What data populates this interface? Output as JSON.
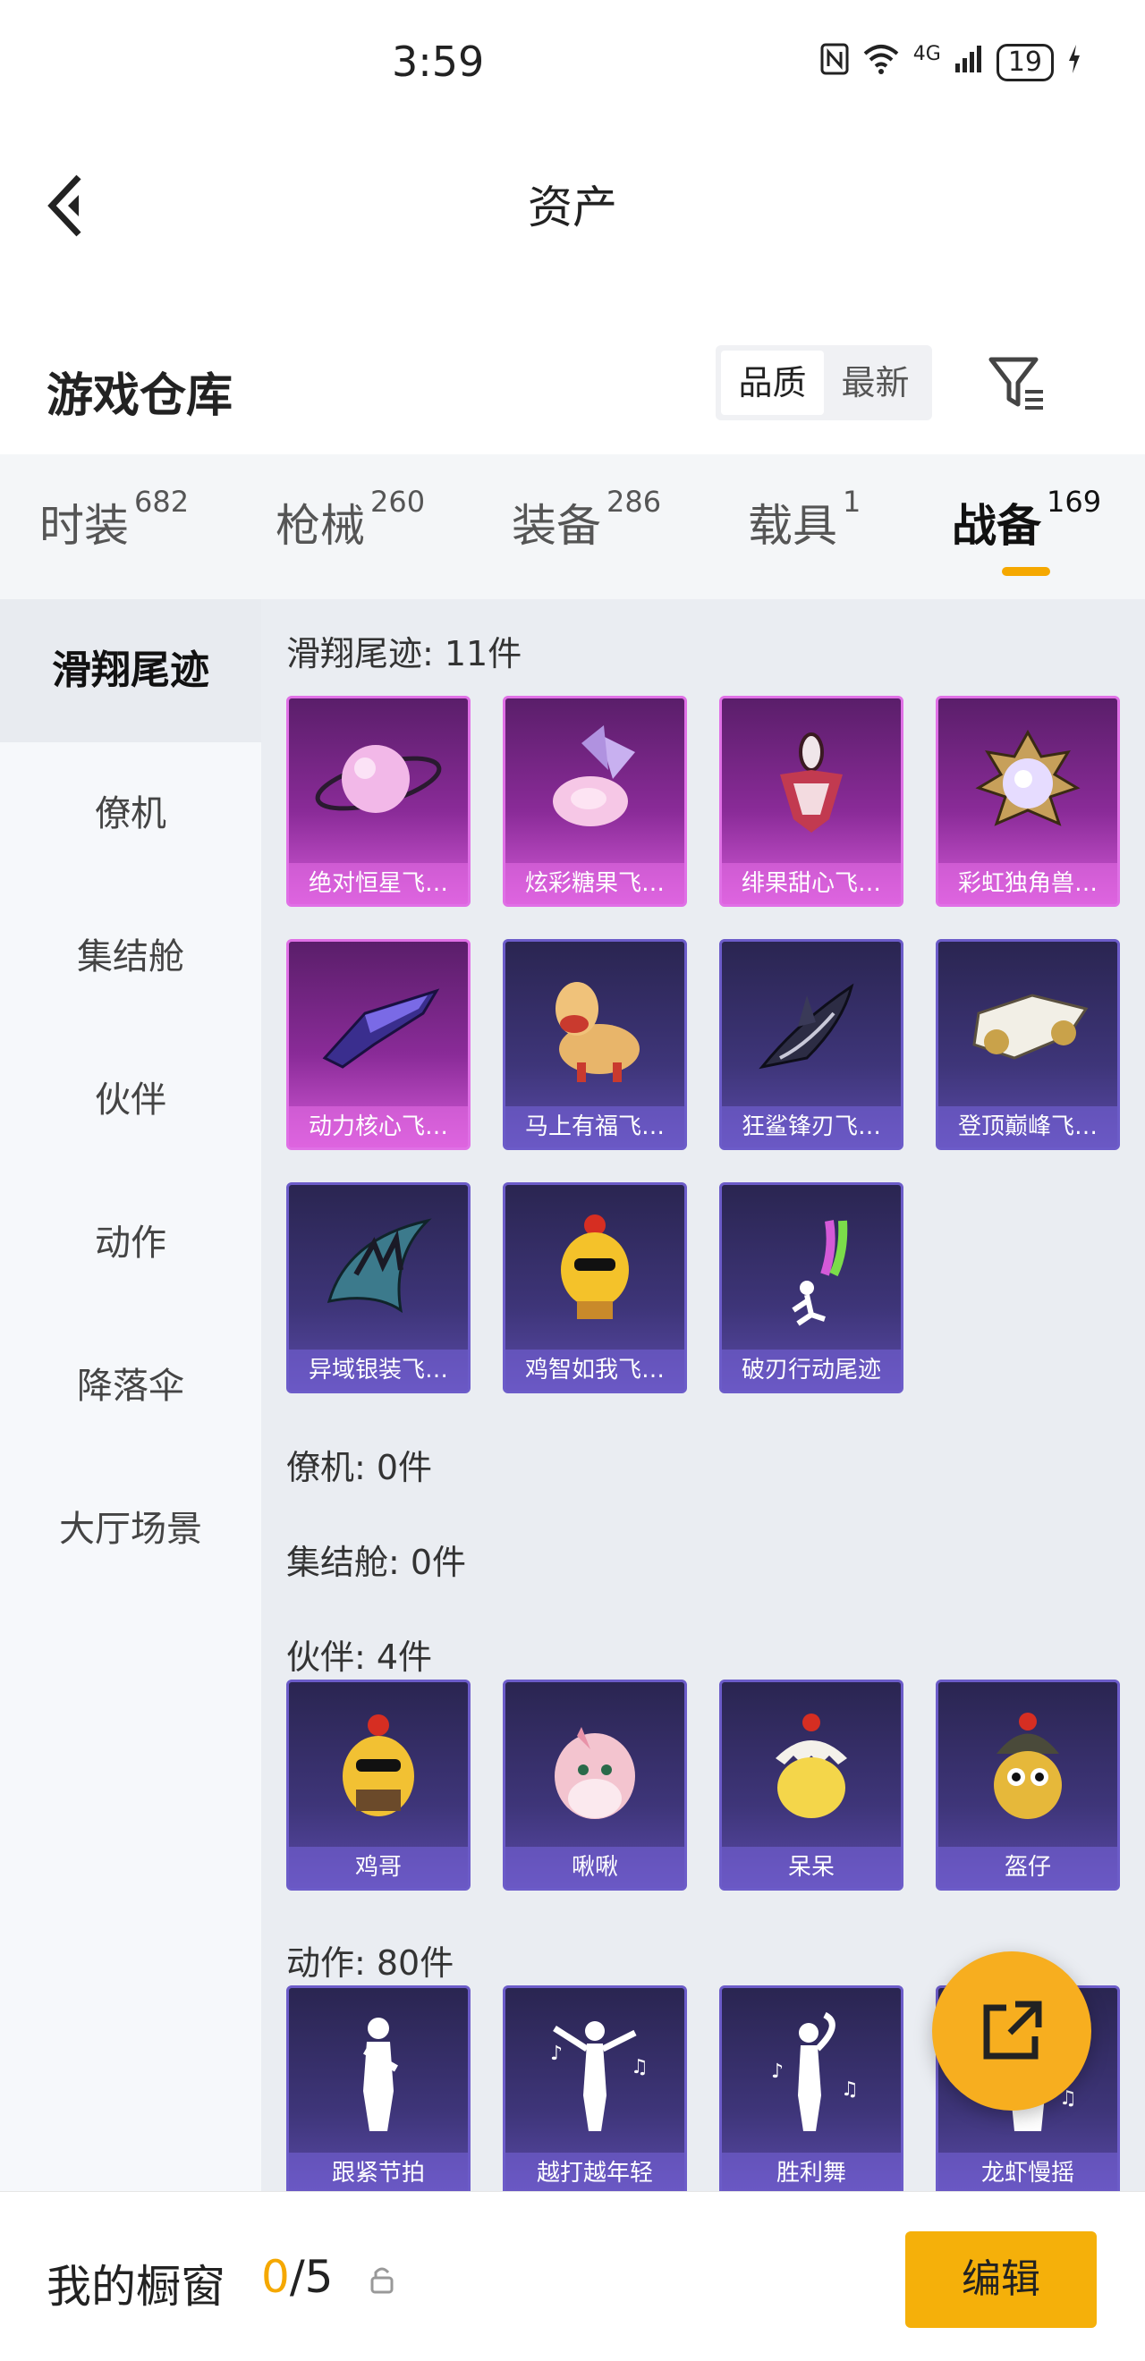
{
  "status_bar": {
    "time": "3:59",
    "network": "4G",
    "battery": "19"
  },
  "header": {
    "title": "资产"
  },
  "warehouse": {
    "title": "游戏仓库",
    "sort_options": [
      "品质",
      "最新"
    ],
    "selected_sort": "品质"
  },
  "tabs": [
    {
      "label": "时装",
      "count": "682"
    },
    {
      "label": "枪械",
      "count": "260"
    },
    {
      "label": "装备",
      "count": "286"
    },
    {
      "label": "载具",
      "count": "1"
    },
    {
      "label": "战备",
      "count": "169"
    }
  ],
  "active_tab": "战备",
  "side_nav": [
    "滑翔尾迹",
    "僚机",
    "集结舱",
    "伙伴",
    "动作",
    "降落伞",
    "大厅场景"
  ],
  "active_side_nav": "滑翔尾迹",
  "sections": {
    "glide": {
      "header": "滑翔尾迹: 11件",
      "items": [
        "绝对恒星飞…",
        "炫彩糖果飞…",
        "绯果甜心飞…",
        "彩虹独角兽…",
        "动力核心飞…",
        "马上有福飞…",
        "狂鲨锋刃飞…",
        "登顶巅峰飞…",
        "异域银装飞…",
        "鸡智如我飞…",
        "破刃行动尾迹"
      ]
    },
    "wingman": {
      "header": "僚机: 0件"
    },
    "capsule": {
      "header": "集结舱: 0件"
    },
    "partner": {
      "header": "伙伴: 4件",
      "items": [
        "鸡哥",
        "啾啾",
        "呆呆",
        "盔仔"
      ]
    },
    "emote": {
      "header": "动作: 80件",
      "items": [
        "跟紧节拍",
        "越打越年轻",
        "胜利舞",
        "龙虾慢摇"
      ]
    }
  },
  "bottom_bar": {
    "label": "我的橱窗",
    "current": "0",
    "total": "/5",
    "edit_button": "编辑"
  },
  "colors": {
    "accent": "#f5a800",
    "card_purple": "#3e3579",
    "card_pink": "#8a2b98"
  },
  "icons": {
    "back": "back-arrow-icon",
    "filter": "filter-icon",
    "share": "share-icon",
    "lock": "lock-icon"
  }
}
